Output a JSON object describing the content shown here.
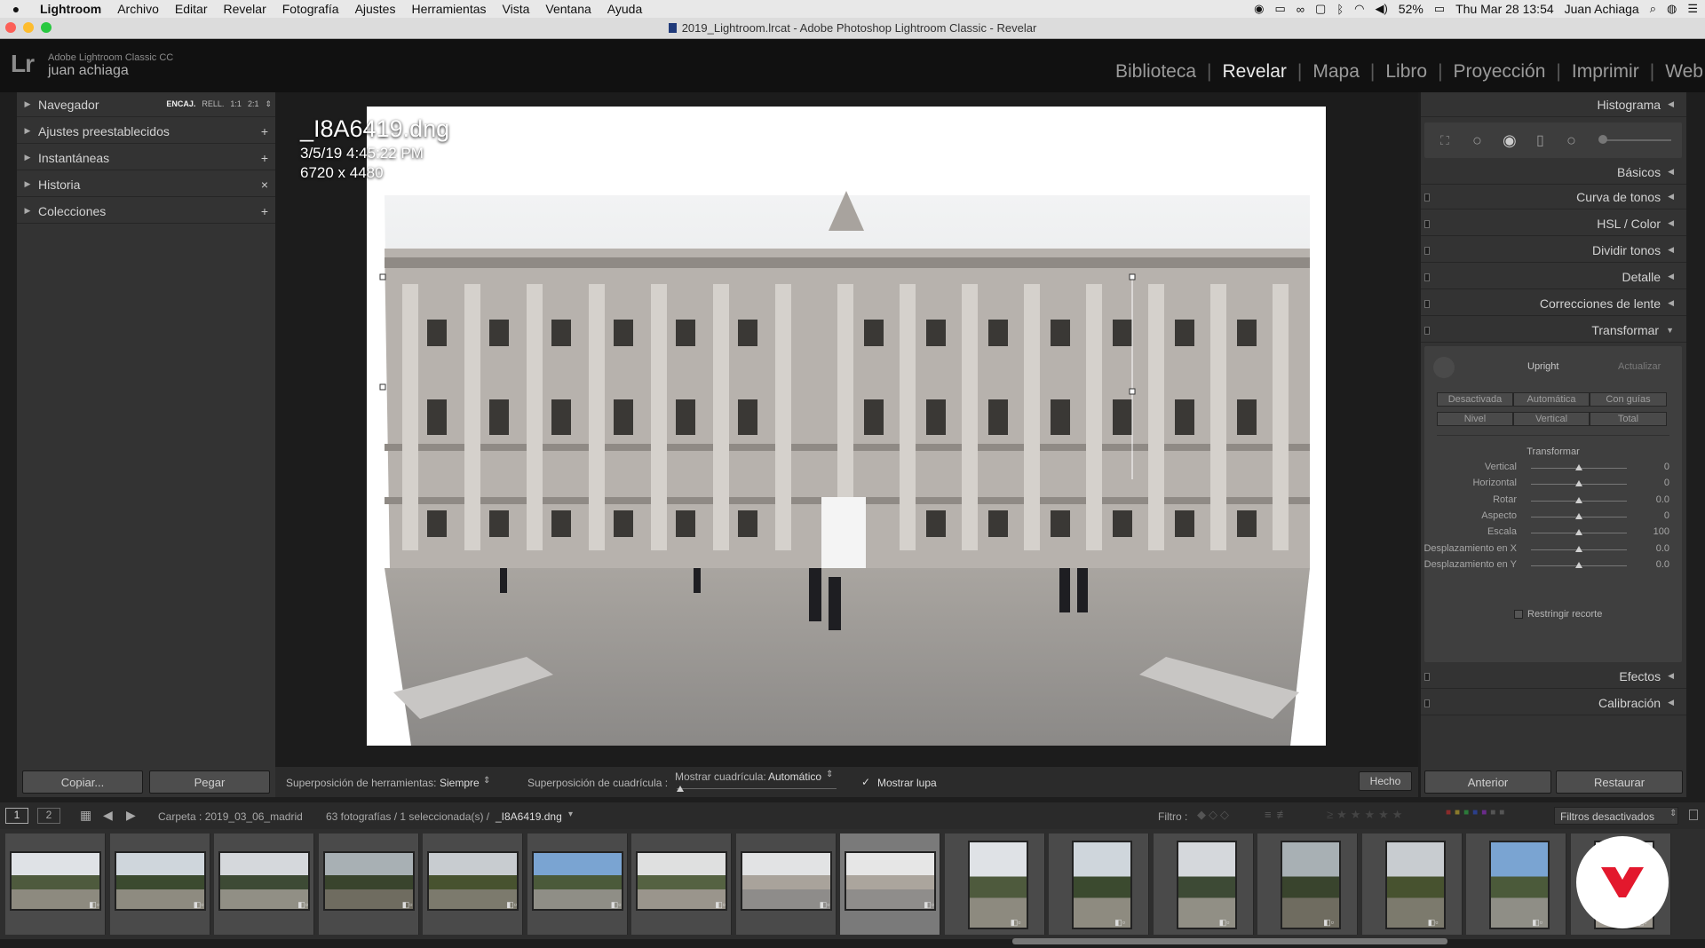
{
  "menubar": {
    "app": "Lightroom",
    "items": [
      "Archivo",
      "Editar",
      "Revelar",
      "Fotografía",
      "Ajustes",
      "Herramientas",
      "Vista",
      "Ventana",
      "Ayuda"
    ],
    "battery": "52%",
    "datetime": "Thu Mar 28  13:54",
    "user": "Juan Achiaga"
  },
  "window": {
    "title": "2019_Lightroom.lrcat - Adobe Photoshop Lightroom Classic - Revelar"
  },
  "identity": {
    "logo": "Lr",
    "product": "Adobe Lightroom Classic CC",
    "user": "juan achiaga"
  },
  "modules": [
    {
      "label": "Biblioteca"
    },
    {
      "label": "Revelar",
      "active": true
    },
    {
      "label": "Mapa"
    },
    {
      "label": "Libro"
    },
    {
      "label": "Proyección"
    },
    {
      "label": "Imprimir"
    },
    {
      "label": "Web"
    }
  ],
  "left_panel": {
    "navigator": {
      "label": "Navegador",
      "zoom": [
        "ENCAJ.",
        "RELL.",
        "1:1",
        "2:1"
      ]
    },
    "items": [
      {
        "label": "Ajustes preestablecidos",
        "action": "+"
      },
      {
        "label": "Instantáneas",
        "action": "+"
      },
      {
        "label": "Historia",
        "action": "×"
      },
      {
        "label": "Colecciones",
        "action": "+"
      }
    ],
    "copy_button": "Copiar...",
    "paste_button": "Pegar"
  },
  "photo": {
    "filename": "_I8A6419.dng",
    "datetime": "3/5/19 4:45:22 PM",
    "dimensions": "6720 x 4480"
  },
  "toolbar": {
    "tool_overlay_label": "Superposición de herramientas:",
    "tool_overlay_value": "Siempre",
    "grid_overlay_label": "Superposición de cuadrícula :",
    "show_grid_label": "Mostrar cuadrícula:",
    "show_grid_value": "Automático",
    "loupe_label": "Mostrar lupa",
    "done_button": "Hecho"
  },
  "right_panel": {
    "histogram": "Histograma",
    "sections": [
      "Básicos",
      "Curva de tonos",
      "HSL / Color",
      "Dividir tonos",
      "Detalle",
      "Correcciones de lente",
      "Transformar"
    ],
    "transform": {
      "upright_label": "Upright",
      "update_button": "Actualizar",
      "upright_buttons": [
        "Desactivada",
        "Automática",
        "Con guías",
        "Nivel",
        "Vertical",
        "Total"
      ],
      "subheader": "Transformar",
      "sliders": [
        {
          "label": "Vertical",
          "value": "0",
          "level": 0.5
        },
        {
          "label": "Horizontal",
          "value": "0",
          "level": 0.5
        },
        {
          "label": "Rotar",
          "value": "0.0",
          "level": 0.5
        },
        {
          "label": "Aspecto",
          "value": "0",
          "level": 0.5
        },
        {
          "label": "Escala",
          "value": "100",
          "level": 0.5
        },
        {
          "label": "Desplazamiento en X",
          "value": "0.0",
          "level": 0.5
        },
        {
          "label": "Desplazamiento en Y",
          "value": "0.0",
          "level": 0.5
        }
      ],
      "constrain_label": "Restringir recorte"
    },
    "after_sections": [
      "Efectos",
      "Calibración"
    ],
    "previous_button": "Anterior",
    "reset_button": "Restaurar"
  },
  "filmstrip": {
    "screens": [
      "1",
      "2"
    ],
    "folder": "Carpeta : 2019_03_06_madrid",
    "count": "63 fotografías / 1 seleccionada(s) / ",
    "selected_file": "_I8A6419.dng",
    "filter_label": "Filtro :",
    "filter_value": "Filtros desactivados"
  }
}
